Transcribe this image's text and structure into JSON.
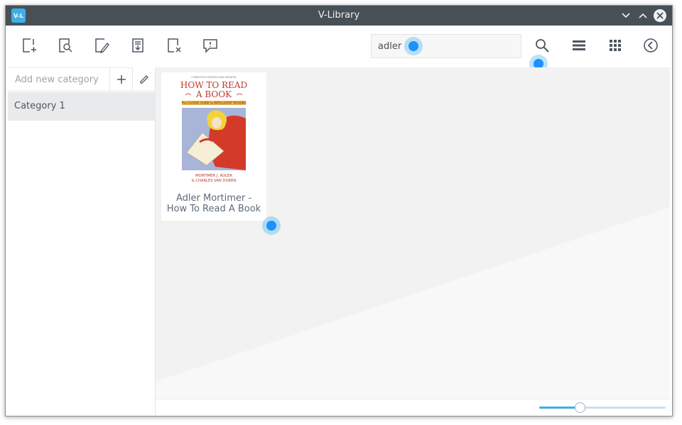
{
  "window": {
    "title": "V-Library",
    "app_icon_text": "V-L"
  },
  "toolbar": {
    "tools": [
      {
        "name": "add-book-icon"
      },
      {
        "name": "search-book-icon"
      },
      {
        "name": "edit-book-icon"
      },
      {
        "name": "import-book-icon"
      },
      {
        "name": "delete-book-icon"
      },
      {
        "name": "comment-icon"
      }
    ],
    "search_value": "adler",
    "right_icons": [
      "search-icon",
      "list-view-icon",
      "grid-view-icon",
      "back-icon"
    ]
  },
  "sidebar": {
    "category_placeholder": "Add new category",
    "categories": [
      "Category 1"
    ]
  },
  "books": [
    {
      "label_line1": "Adler Mortimer -",
      "label_line2": "How To Read A Book",
      "cover": {
        "tagline": "COMPLETELY REVISED AND UPDATED",
        "title1": "HOW TO READ",
        "title2": "A BOOK",
        "subtitle": "The CLASSIC GUIDE to INTELLIGENT READING",
        "author1": "MORTIMER J. ADLER",
        "author2": "& CHARLES VAN DOREN"
      }
    }
  ],
  "zoom": {
    "value_fraction": 0.32
  },
  "colors": {
    "accent": "#3daee9",
    "titlebar": "#475057",
    "cover_red": "#c0392b"
  }
}
